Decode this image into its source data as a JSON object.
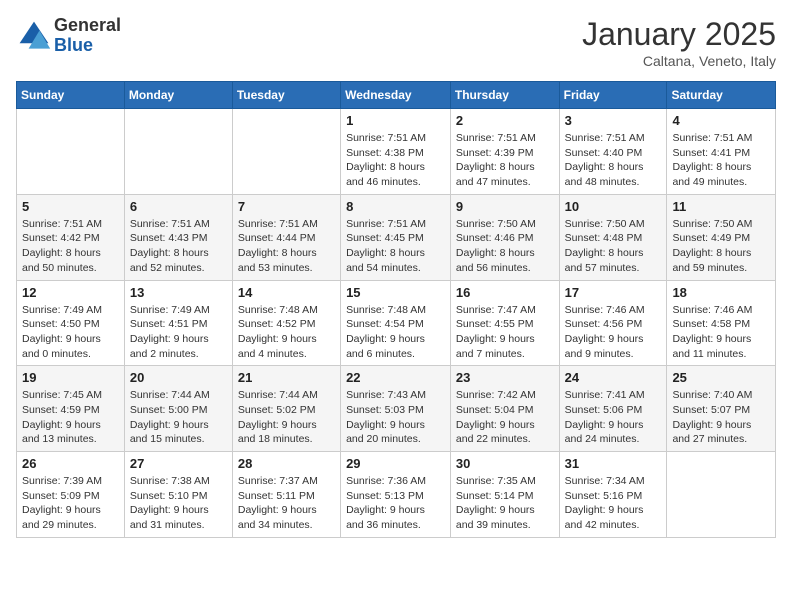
{
  "logo": {
    "general": "General",
    "blue": "Blue"
  },
  "title": "January 2025",
  "location": "Caltana, Veneto, Italy",
  "weekdays": [
    "Sunday",
    "Monday",
    "Tuesday",
    "Wednesday",
    "Thursday",
    "Friday",
    "Saturday"
  ],
  "weeks": [
    [
      {
        "day": "",
        "info": ""
      },
      {
        "day": "",
        "info": ""
      },
      {
        "day": "",
        "info": ""
      },
      {
        "day": "1",
        "info": "Sunrise: 7:51 AM\nSunset: 4:38 PM\nDaylight: 8 hours and 46 minutes."
      },
      {
        "day": "2",
        "info": "Sunrise: 7:51 AM\nSunset: 4:39 PM\nDaylight: 8 hours and 47 minutes."
      },
      {
        "day": "3",
        "info": "Sunrise: 7:51 AM\nSunset: 4:40 PM\nDaylight: 8 hours and 48 minutes."
      },
      {
        "day": "4",
        "info": "Sunrise: 7:51 AM\nSunset: 4:41 PM\nDaylight: 8 hours and 49 minutes."
      }
    ],
    [
      {
        "day": "5",
        "info": "Sunrise: 7:51 AM\nSunset: 4:42 PM\nDaylight: 8 hours and 50 minutes."
      },
      {
        "day": "6",
        "info": "Sunrise: 7:51 AM\nSunset: 4:43 PM\nDaylight: 8 hours and 52 minutes."
      },
      {
        "day": "7",
        "info": "Sunrise: 7:51 AM\nSunset: 4:44 PM\nDaylight: 8 hours and 53 minutes."
      },
      {
        "day": "8",
        "info": "Sunrise: 7:51 AM\nSunset: 4:45 PM\nDaylight: 8 hours and 54 minutes."
      },
      {
        "day": "9",
        "info": "Sunrise: 7:50 AM\nSunset: 4:46 PM\nDaylight: 8 hours and 56 minutes."
      },
      {
        "day": "10",
        "info": "Sunrise: 7:50 AM\nSunset: 4:48 PM\nDaylight: 8 hours and 57 minutes."
      },
      {
        "day": "11",
        "info": "Sunrise: 7:50 AM\nSunset: 4:49 PM\nDaylight: 8 hours and 59 minutes."
      }
    ],
    [
      {
        "day": "12",
        "info": "Sunrise: 7:49 AM\nSunset: 4:50 PM\nDaylight: 9 hours and 0 minutes."
      },
      {
        "day": "13",
        "info": "Sunrise: 7:49 AM\nSunset: 4:51 PM\nDaylight: 9 hours and 2 minutes."
      },
      {
        "day": "14",
        "info": "Sunrise: 7:48 AM\nSunset: 4:52 PM\nDaylight: 9 hours and 4 minutes."
      },
      {
        "day": "15",
        "info": "Sunrise: 7:48 AM\nSunset: 4:54 PM\nDaylight: 9 hours and 6 minutes."
      },
      {
        "day": "16",
        "info": "Sunrise: 7:47 AM\nSunset: 4:55 PM\nDaylight: 9 hours and 7 minutes."
      },
      {
        "day": "17",
        "info": "Sunrise: 7:46 AM\nSunset: 4:56 PM\nDaylight: 9 hours and 9 minutes."
      },
      {
        "day": "18",
        "info": "Sunrise: 7:46 AM\nSunset: 4:58 PM\nDaylight: 9 hours and 11 minutes."
      }
    ],
    [
      {
        "day": "19",
        "info": "Sunrise: 7:45 AM\nSunset: 4:59 PM\nDaylight: 9 hours and 13 minutes."
      },
      {
        "day": "20",
        "info": "Sunrise: 7:44 AM\nSunset: 5:00 PM\nDaylight: 9 hours and 15 minutes."
      },
      {
        "day": "21",
        "info": "Sunrise: 7:44 AM\nSunset: 5:02 PM\nDaylight: 9 hours and 18 minutes."
      },
      {
        "day": "22",
        "info": "Sunrise: 7:43 AM\nSunset: 5:03 PM\nDaylight: 9 hours and 20 minutes."
      },
      {
        "day": "23",
        "info": "Sunrise: 7:42 AM\nSunset: 5:04 PM\nDaylight: 9 hours and 22 minutes."
      },
      {
        "day": "24",
        "info": "Sunrise: 7:41 AM\nSunset: 5:06 PM\nDaylight: 9 hours and 24 minutes."
      },
      {
        "day": "25",
        "info": "Sunrise: 7:40 AM\nSunset: 5:07 PM\nDaylight: 9 hours and 27 minutes."
      }
    ],
    [
      {
        "day": "26",
        "info": "Sunrise: 7:39 AM\nSunset: 5:09 PM\nDaylight: 9 hours and 29 minutes."
      },
      {
        "day": "27",
        "info": "Sunrise: 7:38 AM\nSunset: 5:10 PM\nDaylight: 9 hours and 31 minutes."
      },
      {
        "day": "28",
        "info": "Sunrise: 7:37 AM\nSunset: 5:11 PM\nDaylight: 9 hours and 34 minutes."
      },
      {
        "day": "29",
        "info": "Sunrise: 7:36 AM\nSunset: 5:13 PM\nDaylight: 9 hours and 36 minutes."
      },
      {
        "day": "30",
        "info": "Sunrise: 7:35 AM\nSunset: 5:14 PM\nDaylight: 9 hours and 39 minutes."
      },
      {
        "day": "31",
        "info": "Sunrise: 7:34 AM\nSunset: 5:16 PM\nDaylight: 9 hours and 42 minutes."
      },
      {
        "day": "",
        "info": ""
      }
    ]
  ]
}
